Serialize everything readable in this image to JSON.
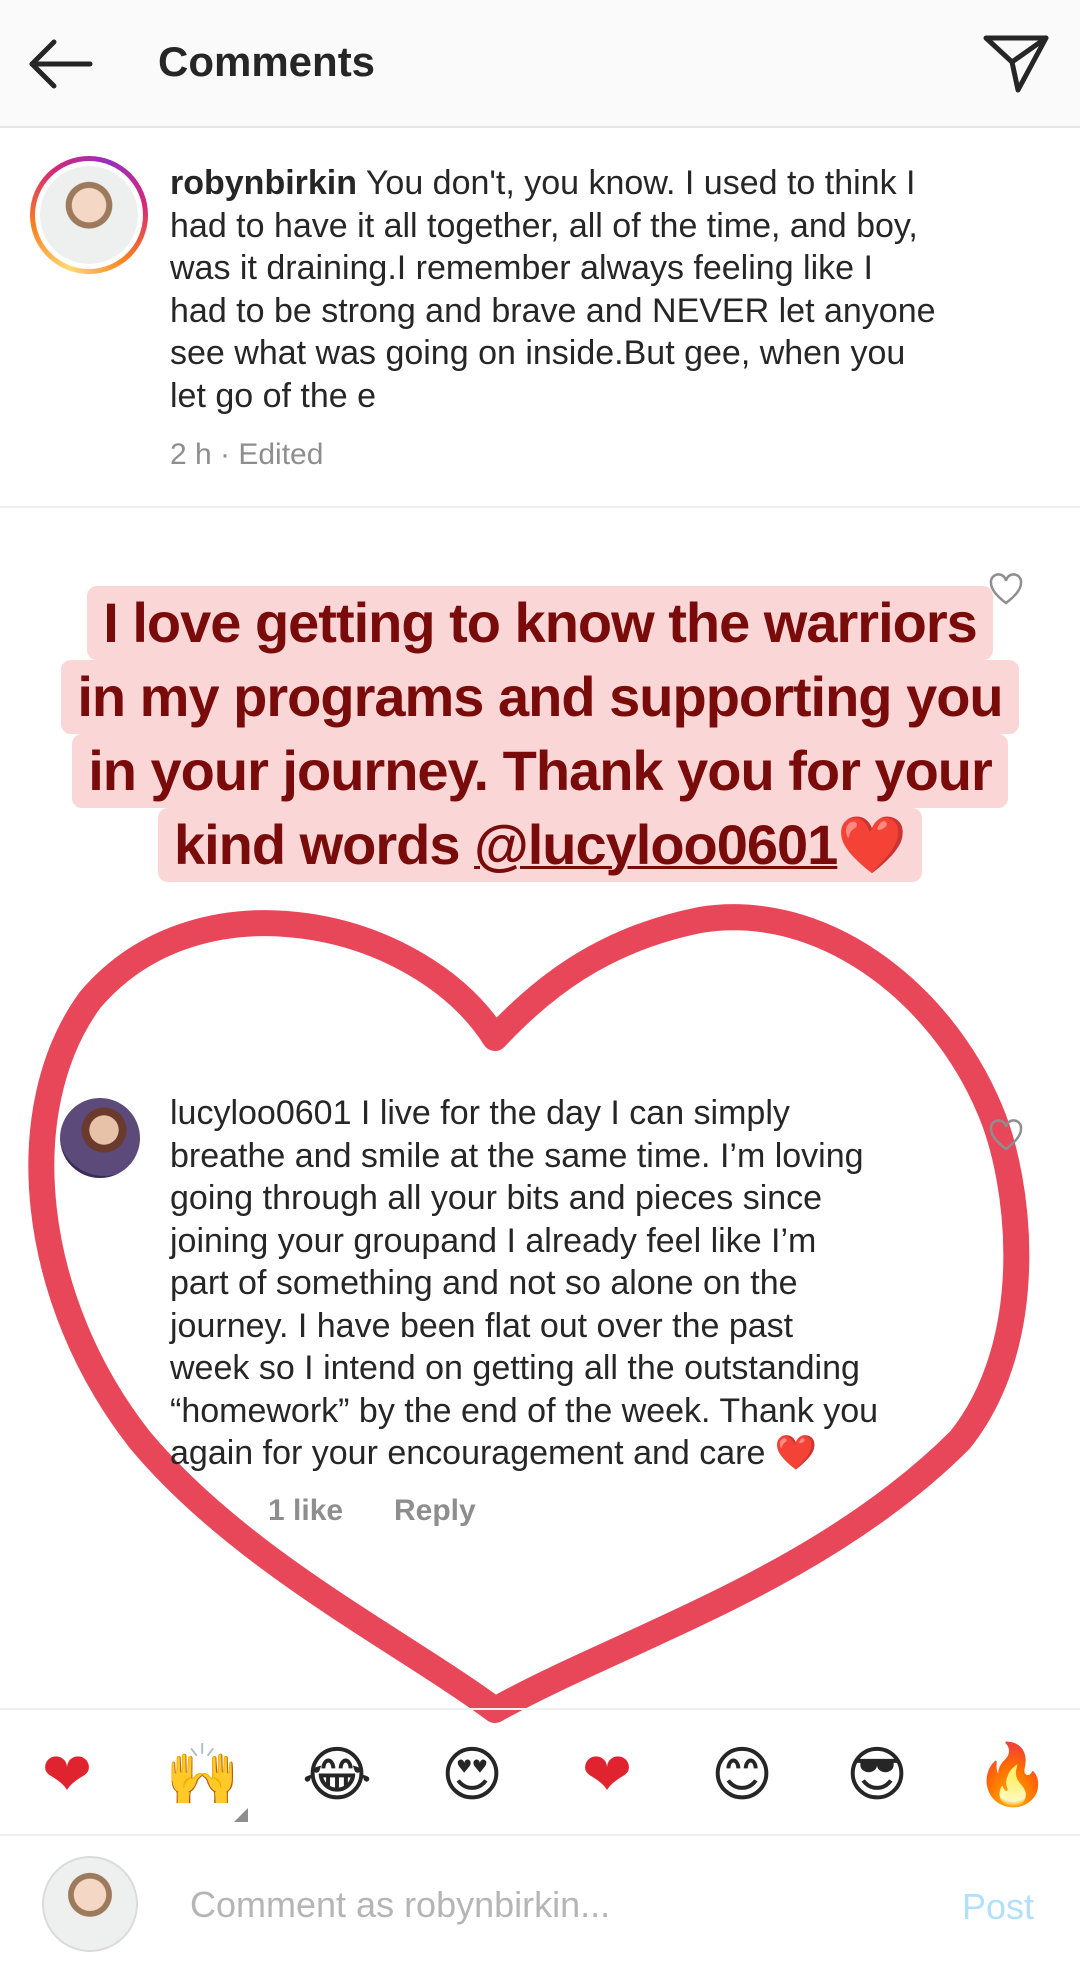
{
  "header": {
    "title": "Comments",
    "back_icon": "arrow-left-icon",
    "share_icon": "paper-plane-icon"
  },
  "comment1": {
    "username": "robynbirkin",
    "lines": [
      " You don't, you know. I used to think I",
      "had to have it all together, all of the time, and boy,",
      "was it draining.I remember always feeling like I",
      "had to be strong and brave and NEVER let anyone",
      "see what was going on inside.But gee, when you",
      "let go of the e"
    ],
    "meta": "2 h · Edited"
  },
  "overlay": {
    "line1": "I love getting to know the warriors",
    "line2": "in my programs and supporting you",
    "line3": "in your journey. Thank you for your",
    "line4_prefix": "kind words ",
    "line4_mention": "@lucyloo0601",
    "line4_emoji": "❤️",
    "color_bg": "#fbd6d6",
    "color_text": "#7a0b0b"
  },
  "comment2": {
    "username": "lucyloo0601",
    "lines": [
      " I live for the day I can simply",
      "breathe and smile at the same time. I’m loving",
      "going through all your bits and pieces since",
      "joining your groupand I already feel like I’m",
      "part of something and not so alone on the",
      "journey. I have been flat out over the past",
      "week so I intend on getting all the outstanding",
      "“homework” by the end of the week. Thank you",
      "again for your encouragement and care "
    ],
    "end_emoji": "❤️",
    "likes": "1 like",
    "reply": "Reply"
  },
  "emoji_bar": [
    "❤",
    "🙌",
    "😂",
    "😍",
    "❤",
    "😊",
    "😎",
    "🔥"
  ],
  "composer": {
    "placeholder": "Comment as robynbirkin...",
    "post_label": "Post"
  },
  "colors": {
    "heart_stroke": "#e8475a",
    "post_disabled": "#b2dffc"
  }
}
